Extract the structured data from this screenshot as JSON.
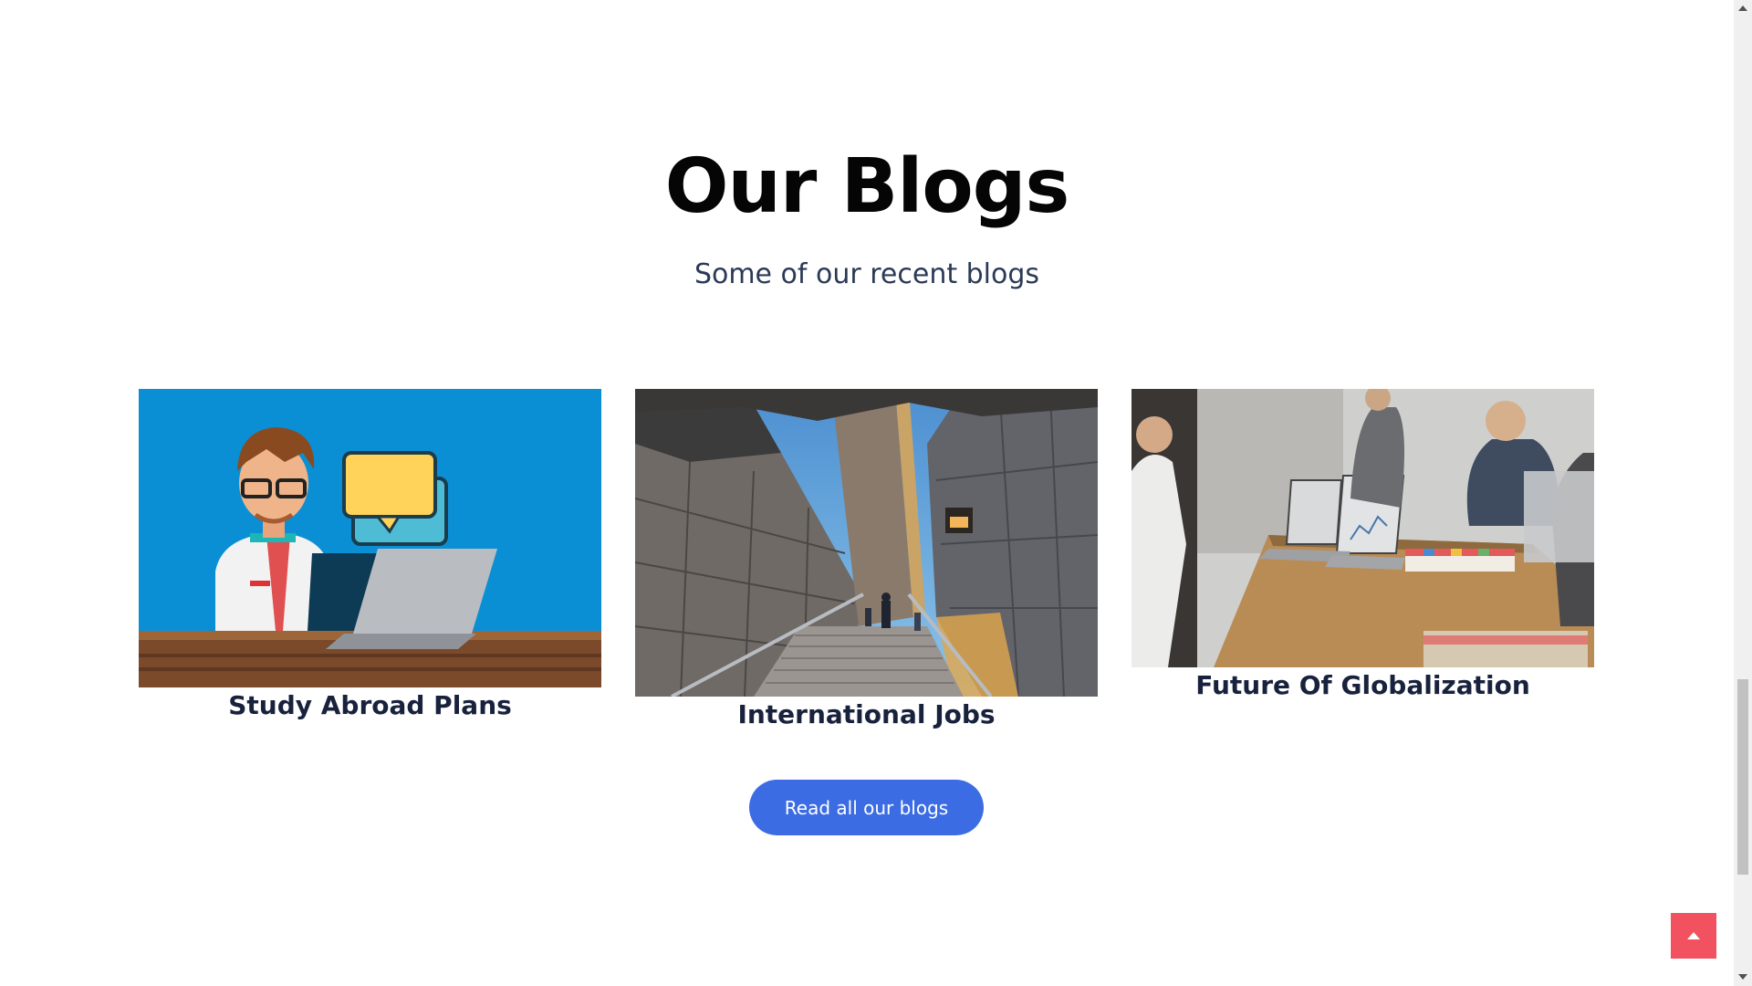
{
  "section": {
    "title": "Our Blogs",
    "subtitle": "Some of our recent blogs"
  },
  "blogs": [
    {
      "title": "Study Abroad Plans",
      "image": "cartoon-student-laptop-image"
    },
    {
      "title": "International Jobs",
      "image": "skyscraper-stairs-photo"
    },
    {
      "title": "Future Of Globalization",
      "image": "office-meeting-photo"
    }
  ],
  "cta": {
    "label": "Read all our blogs"
  },
  "colors": {
    "accent": "#3b6ce3",
    "back_to_top": "#f2525f",
    "heading": "#050505",
    "card_title": "#19223d",
    "subtitle": "#2b3a57"
  },
  "icons": {
    "back_to_top": "arrow-up-icon"
  }
}
